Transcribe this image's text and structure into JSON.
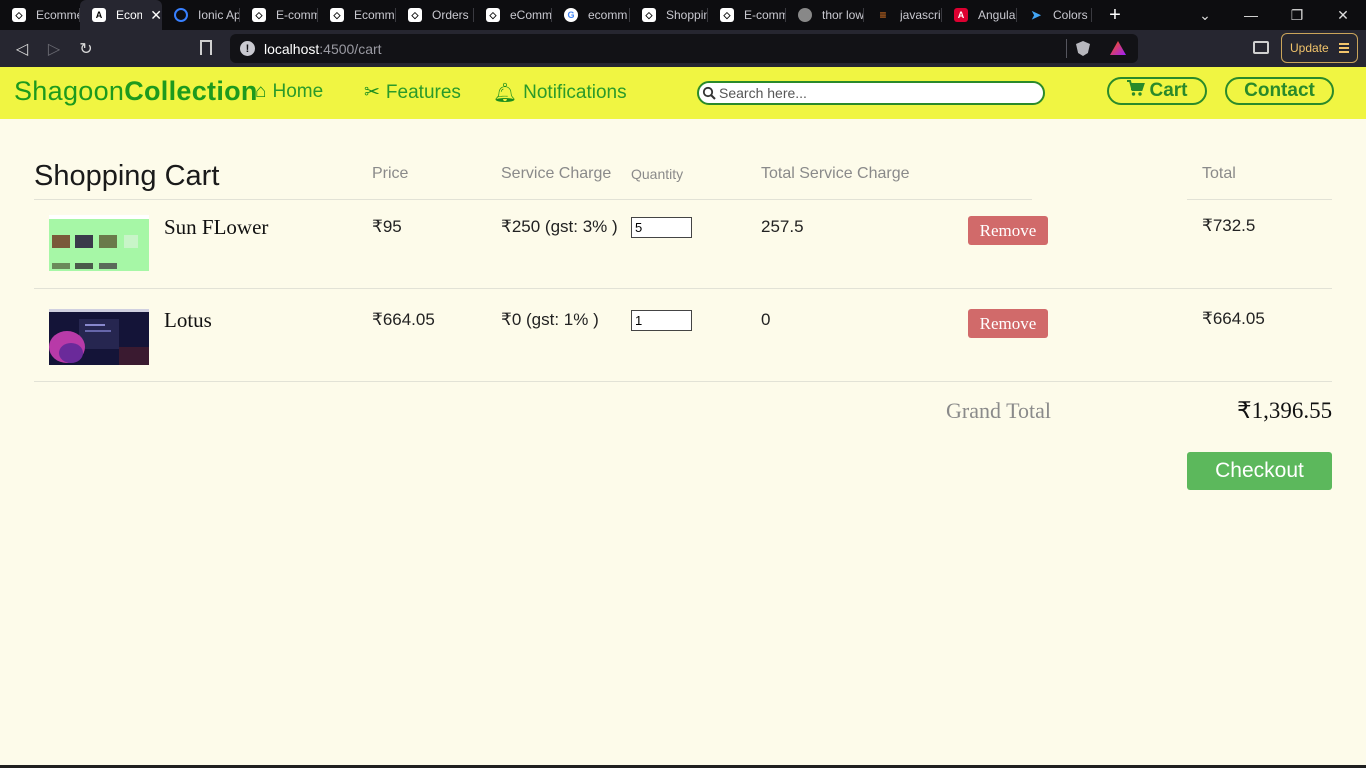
{
  "browser": {
    "tabs": [
      {
        "label": "Ecommerce",
        "icon": "codepen-icon",
        "color": "#ffffff"
      },
      {
        "label": "Ecom",
        "icon": "angular-a-icon",
        "color": "#ffffff",
        "active": true
      },
      {
        "label": "Ionic App",
        "icon": "ionic-icon",
        "color": "#3880ff"
      },
      {
        "label": "E-comm",
        "icon": "codepen-icon",
        "color": "#ffffff"
      },
      {
        "label": "Ecomm",
        "icon": "codepen-icon",
        "color": "#ffffff"
      },
      {
        "label": "Orders",
        "icon": "codepen-icon",
        "color": "#ffffff"
      },
      {
        "label": "eComm",
        "icon": "codepen-icon",
        "color": "#ffffff"
      },
      {
        "label": "ecomm",
        "icon": "google-icon",
        "color": "#ffffff"
      },
      {
        "label": "Shoppin",
        "icon": "codepen-icon",
        "color": "#ffffff"
      },
      {
        "label": "E-comm",
        "icon": "codepen-icon",
        "color": "#ffffff"
      },
      {
        "label": "thor low",
        "icon": "globe-icon",
        "color": "#888888"
      },
      {
        "label": "javascrip",
        "icon": "stackoverflow-icon",
        "color": "#f48024"
      },
      {
        "label": "Angular",
        "icon": "angular-icon",
        "color": "#dd0031"
      },
      {
        "label": "Colors t",
        "icon": "flutter-icon",
        "color": "#42a5f5"
      }
    ],
    "close_glyph": "✕",
    "new_tab_glyph": "+",
    "url_host": "localhost",
    "url_path": ":4500/cart",
    "update_label": "Update"
  },
  "navbar": {
    "brand_part1": "Shagoon",
    "brand_part2": "Collection",
    "links": [
      {
        "label": "Home",
        "icon": "home-icon"
      },
      {
        "label": "Features",
        "icon": "tools-icon"
      },
      {
        "label": "Notifications",
        "icon": "bell-icon"
      }
    ],
    "search_placeholder": "Search here...",
    "cart_label": "Cart",
    "contact_label": "Contact",
    "accent": "#f0f542",
    "brand_color": "#1d9a1d"
  },
  "cart": {
    "title": "Shopping Cart",
    "headers": {
      "price": "Price",
      "service_charge": "Service Charge",
      "quantity": "Quantity",
      "total_service_charge": "Total Service Charge",
      "total": "Total"
    },
    "items": [
      {
        "name": "Sun FLower",
        "price": "₹95",
        "service_charge": "₹250 (gst: 3% )",
        "quantity": "5",
        "total_service_charge": "257.5",
        "remove_label": "Remove",
        "total": "₹732.5"
      },
      {
        "name": "Lotus",
        "price": "₹664.05",
        "service_charge": "₹0 (gst: 1% )",
        "quantity": "1",
        "total_service_charge": "0",
        "remove_label": "Remove",
        "total": "₹664.05"
      }
    ],
    "grand_total_label": "Grand Total",
    "grand_total_value": "₹1,396.55",
    "checkout_label": "Checkout"
  }
}
